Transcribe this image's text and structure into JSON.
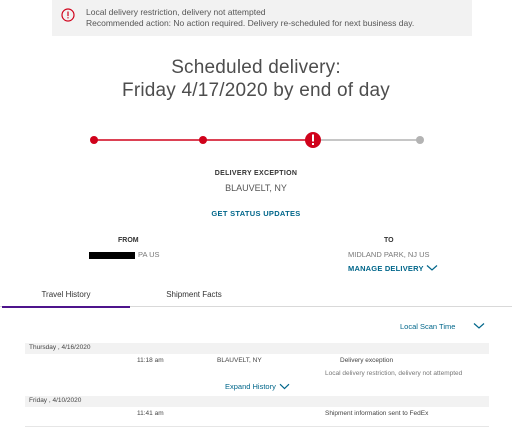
{
  "alert": {
    "line1": "Local delivery restriction, delivery not attempted",
    "line2": "Recommended action: No action required. Delivery re-scheduled for next business day.",
    "icon": "alert-circle-icon",
    "icon_color": "#d0021b"
  },
  "heading": {
    "line1": "Scheduled delivery:",
    "line2": "Friday 4/17/2020 by end of day"
  },
  "progress": {
    "completed_steps": 3,
    "total_steps": 4,
    "active_color": "#d0021b",
    "inactive_color": "#b3b3b3"
  },
  "status": {
    "label": "DELIVERY EXCEPTION",
    "location": "BLAUVELT, NY",
    "link": "GET STATUS UPDATES"
  },
  "shipment": {
    "from_label": "FROM",
    "from_state": "PA US",
    "to_label": "TO",
    "to_city": "MIDLAND PARK, NJ US",
    "manage": "MANAGE DELIVERY"
  },
  "tabs": {
    "travel": "Travel History",
    "facts": "Shipment Facts",
    "accent": "#4d148c"
  },
  "history": {
    "scan_time": "Local Scan Time",
    "expand": "Expand History",
    "days": [
      {
        "date": "Thursday , 4/16/2020",
        "events": [
          {
            "time": "11:18 am",
            "location": "BLAUVELT, NY",
            "description": "Delivery exception",
            "detail": "Local delivery restriction, delivery not attempted"
          }
        ]
      },
      {
        "date": "Friday , 4/10/2020",
        "events": [
          {
            "time": "11:41 am",
            "location": "",
            "description": "Shipment information sent to FedEx",
            "detail": ""
          }
        ]
      }
    ]
  },
  "link_color": "#00668a"
}
